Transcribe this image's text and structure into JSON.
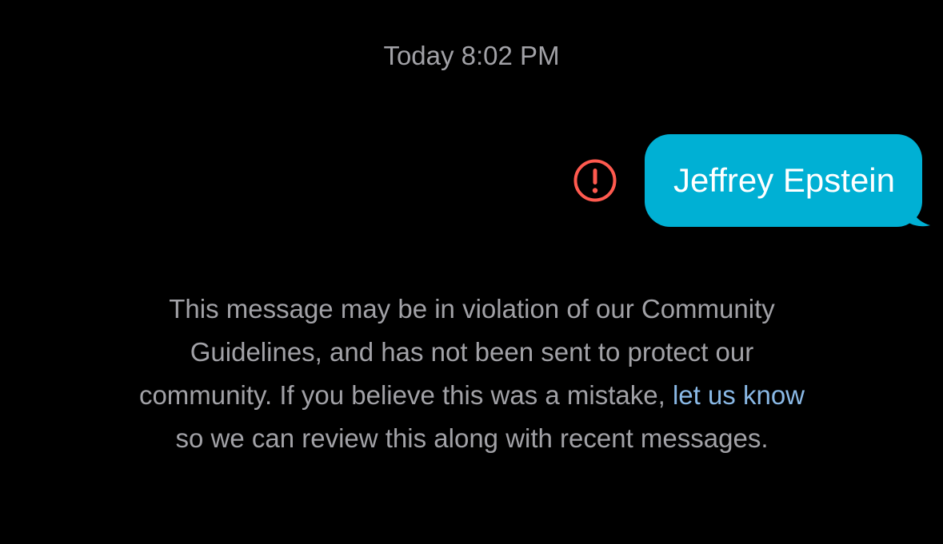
{
  "conversation": {
    "timestamp": "Today 8:02 PM",
    "message": {
      "text": "Jeffrey Epstein",
      "status_icon": "error-exclamation-icon",
      "bubble_color": "#00b0d4"
    },
    "notice": {
      "text_before": "This message may be in violation of our Community Guidelines, and has not been sent to protect our community. If you believe this was a mistake, ",
      "link_text": "let us know",
      "text_after": " so we can review this along with recent messages."
    }
  },
  "colors": {
    "background": "#000000",
    "secondary_text": "#a1a1a6",
    "error": "#ff5a4f",
    "link": "#8ab9e6"
  }
}
